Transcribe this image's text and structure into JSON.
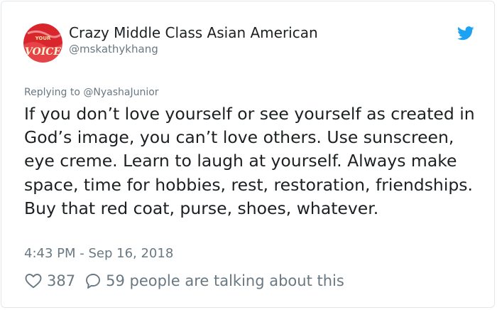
{
  "tweet": {
    "author_name": "Crazy Middle Class Asian American",
    "author_handle": "@mskathykhang",
    "avatar_text": [
      "YOUR",
      "VOICE"
    ],
    "reply_prefix": "Replying to ",
    "reply_handle": "@NyashaJunior",
    "text": "If you don’t love yourself or see yourself as created in God’s image, you can’t love others. Use sunscreen, eye creme. Learn to laugh at yourself. Always make space, time for hobbies, rest, restoration, friendships. Buy that red coat, purse, shoes, whatever.",
    "timestamp": "4:43 PM - Sep 16, 2018",
    "like_count": "387",
    "talking_text": "59 people are talking about this"
  },
  "colors": {
    "text": "#1c2022",
    "muted": "#697882",
    "twitter_blue": "#1da1f2",
    "avatar_red": "#d9262d"
  },
  "icons": [
    "twitter-bird-icon",
    "heart-icon",
    "speech-bubble-icon"
  ]
}
